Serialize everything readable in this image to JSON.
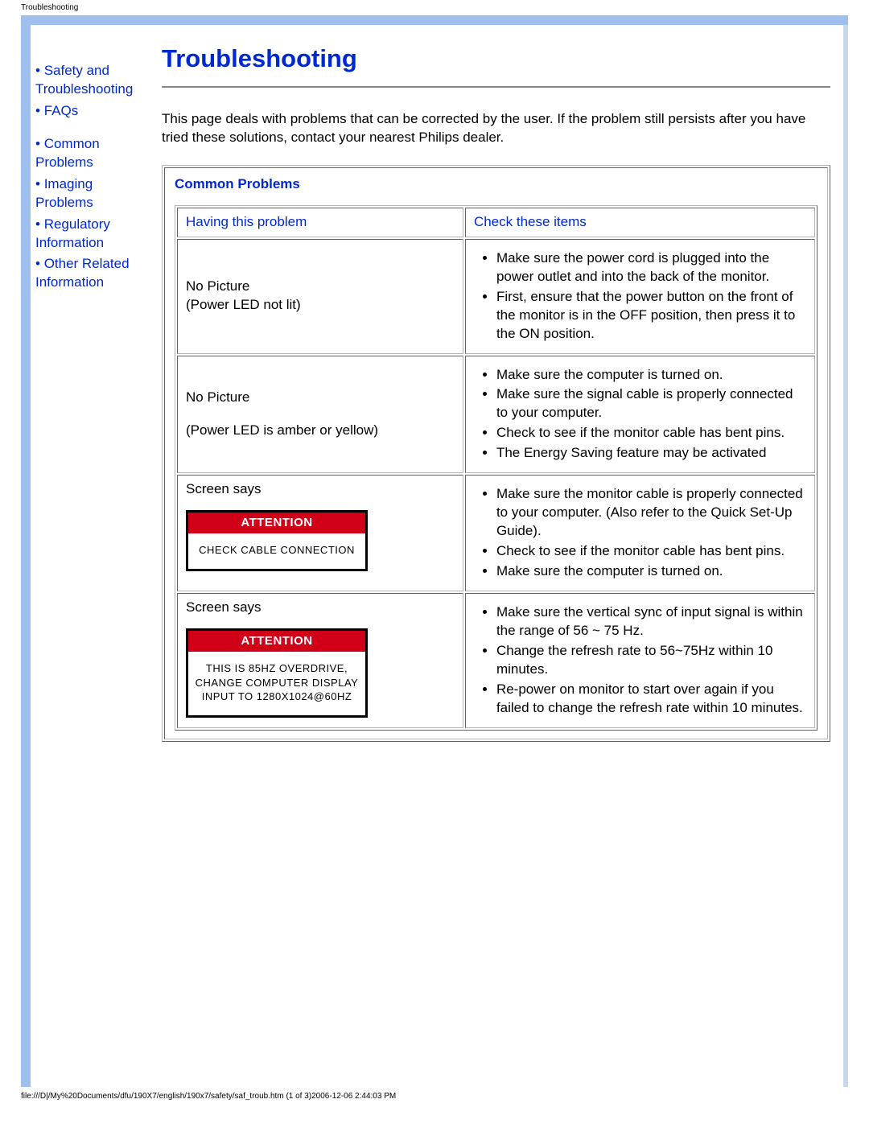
{
  "meta": {
    "header_title": "Troubleshooting",
    "footer": "file:///D|/My%20Documents/dfu/190X7/english/190x7/safety/saf_troub.htm (1 of 3)2006-12-06 2:44:03 PM"
  },
  "sidebar": {
    "items": [
      {
        "label": "Safety and Troubleshooting"
      },
      {
        "label": "FAQs"
      },
      {
        "label": "Common Problems"
      },
      {
        "label": "Imaging Problems"
      },
      {
        "label": "Regulatory Information"
      },
      {
        "label": "Other Related Information"
      }
    ]
  },
  "page": {
    "title": "Troubleshooting",
    "intro": "This page deals with problems that can be corrected by the user. If the problem still persists after you have tried these solutions, contact your nearest Philips dealer."
  },
  "table": {
    "section_title": "Common Problems",
    "col1": "Having this problem",
    "col2": "Check these items",
    "rows": [
      {
        "problem_lines": [
          "No Picture",
          "(Power LED not lit)"
        ],
        "checks": [
          "Make sure the power cord is plugged into the power outlet and into the back of the monitor.",
          "First, ensure that the power button on the front of the monitor is in the OFF position, then press it to the ON position."
        ]
      },
      {
        "problem_lines": [
          "No Picture",
          "",
          "(Power LED is amber or yellow)"
        ],
        "checks": [
          "Make sure the computer is turned on.",
          "Make sure the signal cable is properly connected to your computer.",
          "Check to see if the monitor cable has bent pins.",
          "The Energy Saving feature may be activated"
        ]
      },
      {
        "problem_label": "Screen says",
        "attention": {
          "title": "ATTENTION",
          "body": "CHECK CABLE CONNECTION"
        },
        "checks": [
          "Make sure the monitor cable is properly connected to your computer. (Also refer to the Quick Set-Up Guide).",
          "Check to see if the monitor cable has bent pins.",
          "Make sure the computer is turned on."
        ]
      },
      {
        "problem_label": "Screen says",
        "attention": {
          "title": "ATTENTION",
          "body": "THIS IS 85HZ OVERDRIVE, CHANGE COMPUTER DISPLAY INPUT TO 1280X1024@60HZ"
        },
        "checks": [
          "Make sure the vertical sync of input signal is within the range of 56 ~ 75 Hz.",
          "Change the refresh rate to 56~75Hz within 10 minutes.",
          "Re-power on monitor to start over again if you failed to change the refresh rate within 10 minutes."
        ]
      }
    ]
  }
}
